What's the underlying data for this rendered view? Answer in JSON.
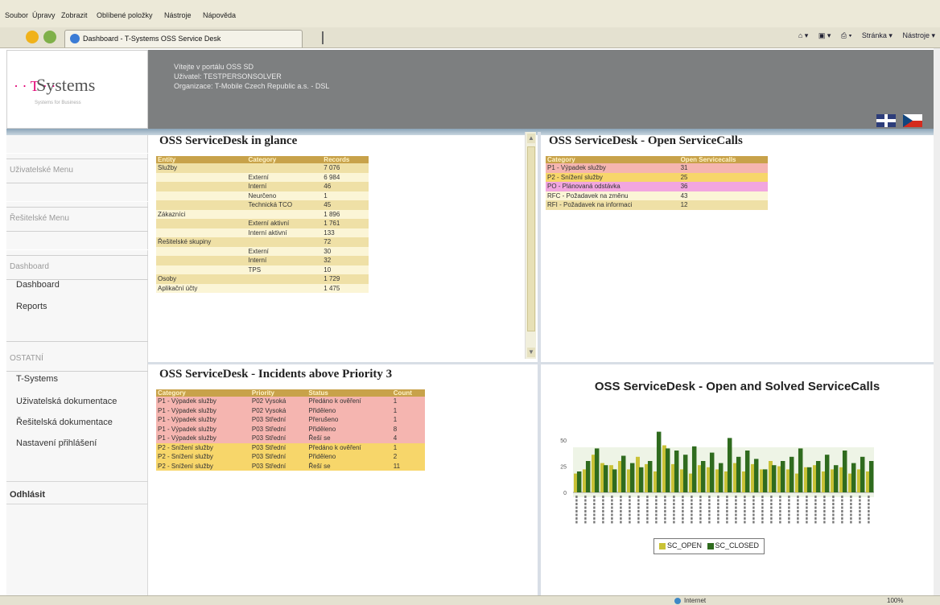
{
  "browser": {
    "menu": [
      "Soubor",
      "Úpravy",
      "Zobrazit",
      "Oblíbené položky",
      "Nástroje",
      "Nápověda"
    ],
    "tab_title": "Dashboard - T-Systems OSS Service Desk",
    "commands": [
      "Stránka ▾",
      "Nástroje ▾"
    ],
    "status_zone": "Internet",
    "zoom": "100%"
  },
  "header": {
    "logo_text": "Systems",
    "logo_dots": "· · T · ·",
    "logo_subtitle": "Systems for Business",
    "welcome": "Vítejte v portálu OSS SD",
    "user": "Uživatel: TESTPERSONSOLVER",
    "organization": "Organizace: T-Mobile Czech Republic a.s. - DSL"
  },
  "sidebar": {
    "user_menu": "Uživatelské Menu",
    "solver_menu": "Řešitelské Menu",
    "dashboard_head": "Dashboard",
    "dashboard_items": [
      "Dashboard",
      "Reports"
    ],
    "other_head": "OSTATNÍ",
    "other_items": [
      "T-Systems",
      "Uživatelská dokumentace",
      "Řešitelská dokumentace",
      "Nastavení přihlášení"
    ],
    "logout": "Odhlásit"
  },
  "glance": {
    "title": "OSS ServiceDesk in glance",
    "columns": [
      "Entity",
      "Category",
      "Records"
    ],
    "rows": [
      [
        "Služby",
        "",
        "7 076"
      ],
      [
        "",
        "Externí",
        "6 984"
      ],
      [
        "",
        "Interní",
        "46"
      ],
      [
        "",
        "Neurčeno",
        "1"
      ],
      [
        "",
        "Technická TCO",
        "45"
      ],
      [
        "Zákazníci",
        "",
        "1 896"
      ],
      [
        "",
        "Externí aktivní",
        "1 761"
      ],
      [
        "",
        "Interní aktivní",
        "133"
      ],
      [
        "Řešitelské skupiny",
        "",
        "72"
      ],
      [
        "",
        "Externí",
        "30"
      ],
      [
        "",
        "Interní",
        "32"
      ],
      [
        "",
        "TPS",
        "10"
      ],
      [
        "Osoby",
        "",
        "1 729"
      ],
      [
        "Aplikační účty",
        "",
        "1 475"
      ]
    ]
  },
  "open_calls": {
    "title": "OSS ServiceDesk - Open ServiceCalls",
    "columns": [
      "Category",
      "Open Servicecalls"
    ],
    "rows": [
      [
        "P1 - Výpadek služby",
        "31"
      ],
      [
        "P2 - Snížení služby",
        "25"
      ],
      [
        "PO - Plánovaná odstávka",
        "36"
      ],
      [
        "RFC - Požadavek na změnu",
        "43"
      ],
      [
        "RFI - Požadavek na informaci",
        "12"
      ]
    ]
  },
  "incidents": {
    "title": "OSS ServiceDesk - Incidents above Priority 3",
    "columns": [
      "Category",
      "Priority",
      "Status",
      "Count"
    ],
    "rows": [
      [
        "P1 - Výpadek služby",
        "P02 Vysoká",
        "Předáno k ověření",
        "1"
      ],
      [
        "P1 - Výpadek služby",
        "P02 Vysoká",
        "Přiděleno",
        "1"
      ],
      [
        "P1 - Výpadek služby",
        "P03 Střední",
        "Přerušeno",
        "1"
      ],
      [
        "P1 - Výpadek služby",
        "P03 Střední",
        "Přiděleno",
        "8"
      ],
      [
        "P1 - Výpadek služby",
        "P03 Střední",
        "Řeší se",
        "4"
      ],
      [
        "P2 - Snížení služby",
        "P03 Střední",
        "Předáno k ověření",
        "1"
      ],
      [
        "P2 - Snížení služby",
        "P03 Střední",
        "Přiděleno",
        "2"
      ],
      [
        "P2 - Snížení služby",
        "P03 Střední",
        "Řeší se",
        "11"
      ]
    ]
  },
  "colors": {
    "header_bg": "#7d7f80",
    "table_header": "#c8a24a",
    "row_p1": "#f5b5b0",
    "row_po": "#f2a6df",
    "row_p2": "#f7d66a",
    "series_open": "#c9c236",
    "series_closed": "#2f6b1e"
  },
  "chart_data": {
    "type": "bar",
    "title": "OSS ServiceDesk - Open and Solved ServiceCalls",
    "ylim": [
      0,
      60
    ],
    "yticks": [
      0,
      25,
      50
    ],
    "legend_position": "bottom",
    "series": [
      {
        "name": "SC_OPEN",
        "values": [
          18,
          22,
          36,
          28,
          26,
          30,
          22,
          34,
          27,
          20,
          45,
          27,
          22,
          18,
          26,
          24,
          22,
          20,
          28,
          20,
          27,
          22,
          30,
          25,
          22,
          18,
          24,
          26,
          20,
          22,
          24,
          18,
          22,
          20
        ]
      },
      {
        "name": "SC_CLOSED",
        "values": [
          20,
          30,
          42,
          26,
          22,
          35,
          28,
          24,
          30,
          58,
          42,
          40,
          36,
          44,
          30,
          38,
          28,
          52,
          34,
          40,
          32,
          22,
          26,
          30,
          34,
          42,
          24,
          30,
          36,
          26,
          40,
          28,
          34,
          30
        ]
      }
    ]
  }
}
